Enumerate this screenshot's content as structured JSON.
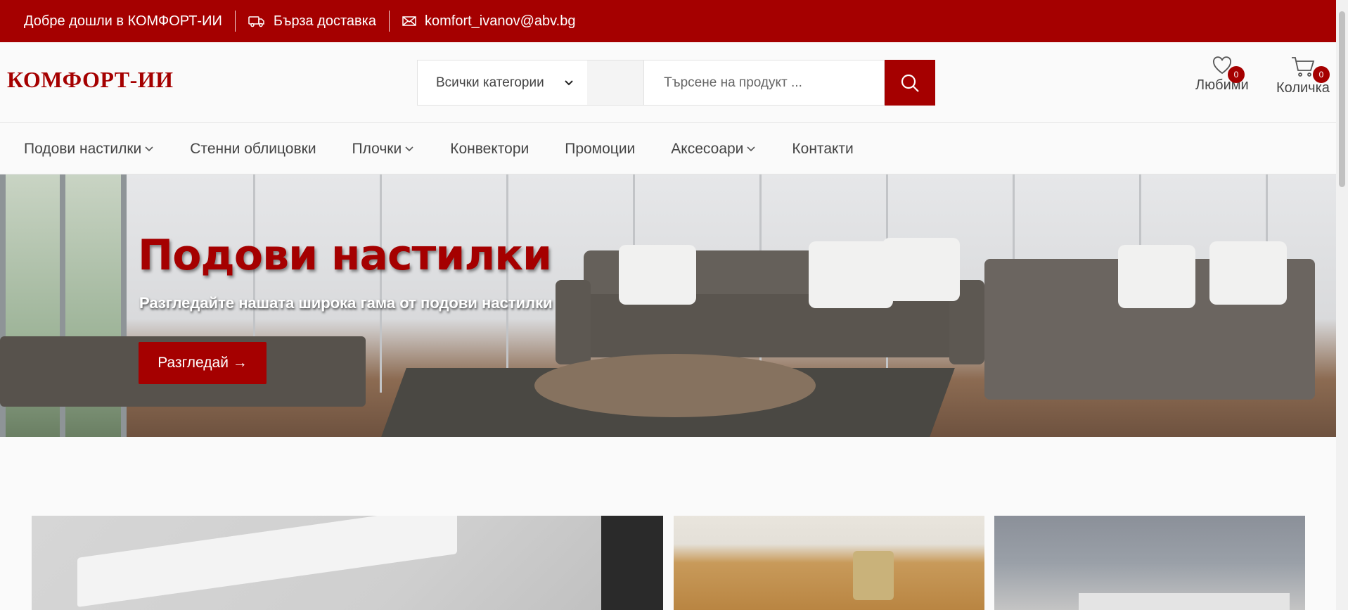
{
  "topbar": {
    "welcome": "Добре дошли в КОМФОРТ-ИИ",
    "delivery": "Бърза доставка",
    "email": "komfort_ivanov@abv.bg",
    "icons": [
      "truck-icon",
      "mail-icon"
    ]
  },
  "header": {
    "logo": "КОМФОРТ-ИИ",
    "category_select": "Всички категории",
    "search_placeholder": "Търсене на продукт ...",
    "favorites": {
      "label": "Любими",
      "count": "0"
    },
    "cart": {
      "label": "Количка",
      "count": "0"
    }
  },
  "nav": {
    "items": [
      {
        "label": "Подови настилки",
        "dropdown": true
      },
      {
        "label": "Стенни облицовки",
        "dropdown": false
      },
      {
        "label": "Плочки",
        "dropdown": true
      },
      {
        "label": "Конвектори",
        "dropdown": false
      },
      {
        "label": "Промоции",
        "dropdown": false
      },
      {
        "label": "Аксесоари",
        "dropdown": true
      },
      {
        "label": "Контакти",
        "dropdown": false
      }
    ]
  },
  "hero": {
    "title": "Подови настилки",
    "subtitle": "Разгледайте нашата широка гама от подови настилки",
    "button": "Разгледай →"
  },
  "colors": {
    "accent": "#a50000",
    "background": "#fafafa"
  }
}
